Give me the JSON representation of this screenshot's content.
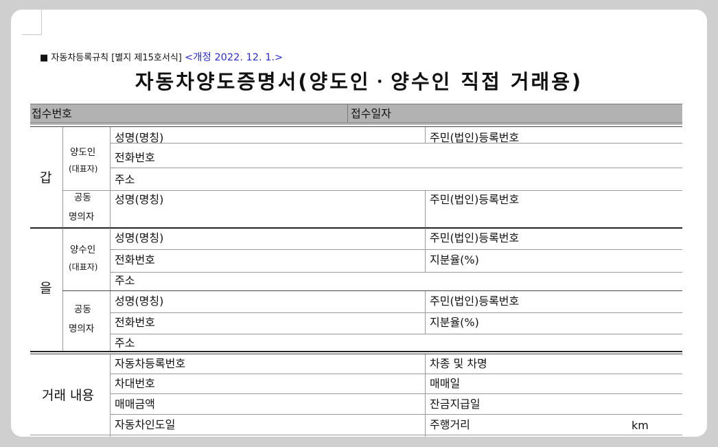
{
  "form_ref": {
    "prefix": "■ 자동차등록규칙 [별지 제15호서식]",
    "revision": "<개정 2022. 12. 1.>"
  },
  "title": "자동차양도증명서(양도인ㆍ양수인 직접 거래용)",
  "receipt": {
    "number_label": "접수번호",
    "date_label": "접수일자"
  },
  "party_a": {
    "label": "갑",
    "transferor_label": "양도인",
    "representative_label": "(대표자)",
    "co_owner_label_1": "공동",
    "co_owner_label_2": "명의자",
    "name_label": "성명(명칭)",
    "id_label": "주민(법인)등록번호",
    "phone_label": "전화번호",
    "address_label": "주소"
  },
  "party_b": {
    "label": "을",
    "transferee_label": "양수인",
    "representative_label": "(대표자)",
    "co_owner_label_1": "공동",
    "co_owner_label_2": "명의자",
    "name_label": "성명(명칭)",
    "id_label": "주민(법인)등록번호",
    "phone_label": "전화번호",
    "share_label": "지분율(%)",
    "address_label": "주소"
  },
  "transaction": {
    "label": "거래 내용",
    "reg_no": "자동차등록번호",
    "model": "차종 및 차명",
    "vin": "차대번호",
    "sale_date": "매매일",
    "price": "매매금액",
    "balance_date": "잔금지급일",
    "delivery_date": "자동차인도일",
    "mileage": "주행거리",
    "mileage_unit": "km"
  }
}
